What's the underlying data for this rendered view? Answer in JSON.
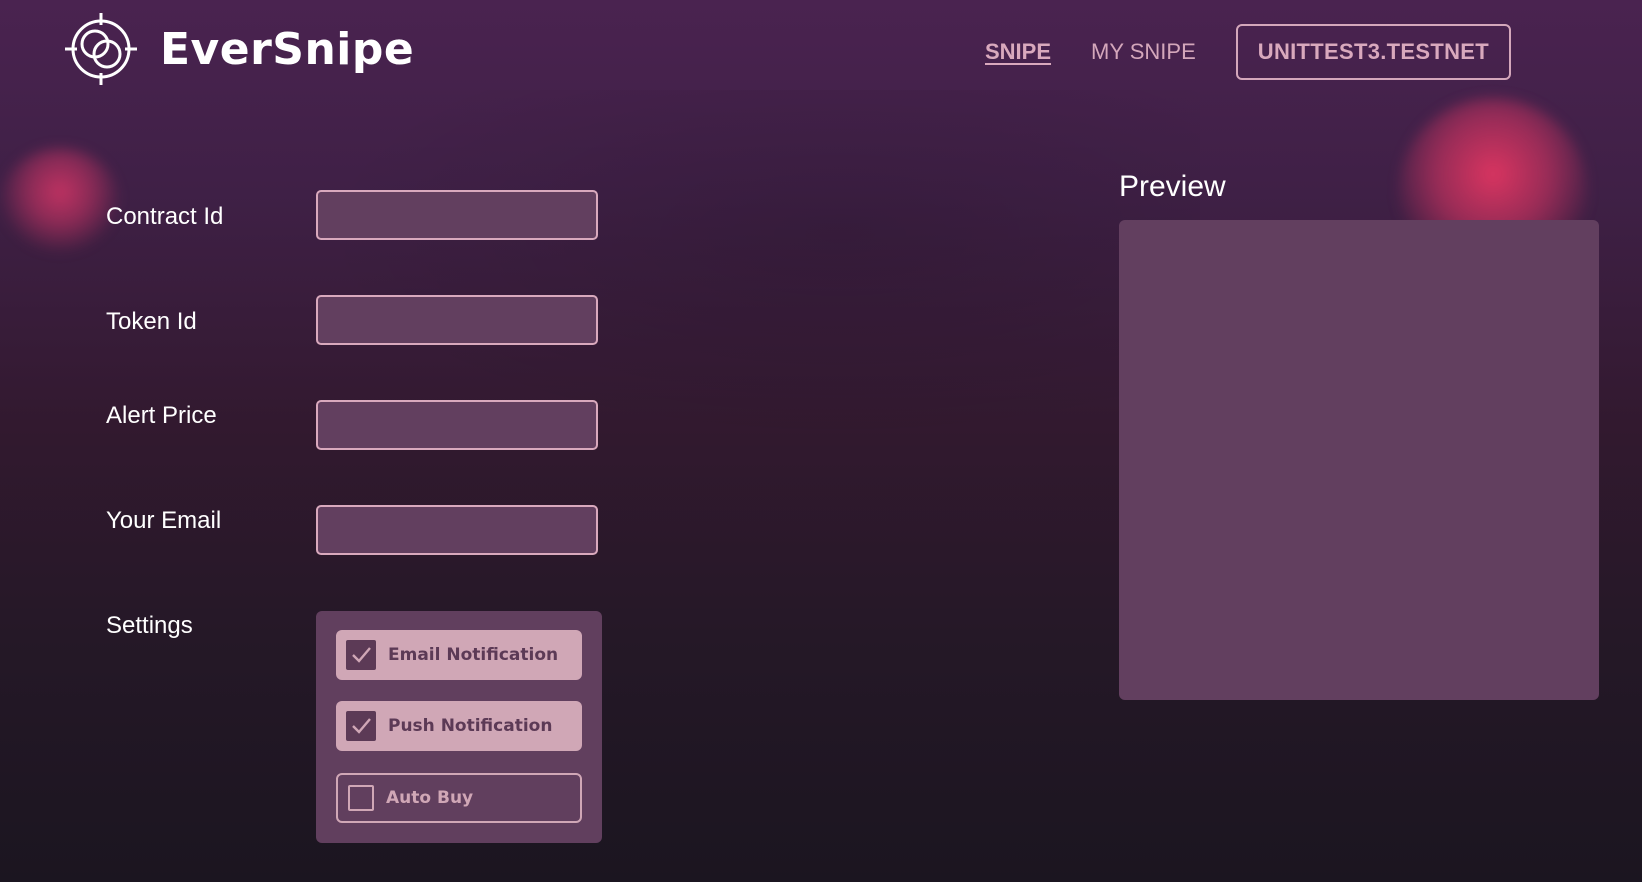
{
  "header": {
    "logo_text": "EverSnipe",
    "nav": [
      {
        "label": "SNIPE",
        "active": true
      },
      {
        "label": "MY SNIPE",
        "active": false
      }
    ],
    "account_label": "UNITTEST3.TESTNET"
  },
  "form": {
    "contract_id": {
      "label": "Contract Id",
      "value": ""
    },
    "token_id": {
      "label": "Token Id",
      "value": ""
    },
    "alert_price": {
      "label": "Alert Price",
      "value": ""
    },
    "email": {
      "label": "Your Email",
      "value": ""
    },
    "settings": {
      "label": "Settings",
      "options": [
        {
          "label": "Email Notification",
          "checked": true
        },
        {
          "label": "Push Notification",
          "checked": true
        },
        {
          "label": "Auto Buy",
          "checked": false
        }
      ]
    }
  },
  "preview": {
    "title": "Preview"
  },
  "colors": {
    "accent": "#d9a9bd",
    "panel": "#623f5f",
    "glow": "#e03662",
    "checked_bg": "#d0a7b6",
    "checked_fg": "#5c3a56"
  },
  "icons": {
    "logo": "crosshair-logo-icon",
    "check": "checkmark-icon"
  }
}
